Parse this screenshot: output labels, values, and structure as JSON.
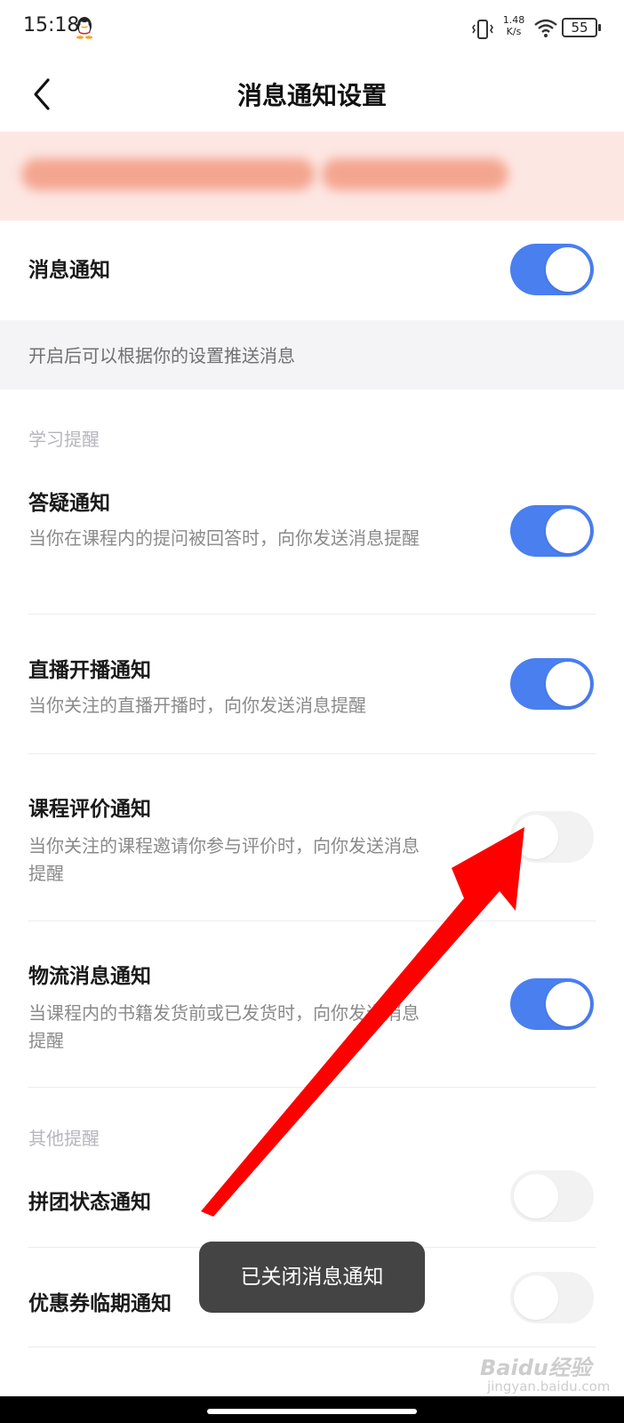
{
  "status_bar": {
    "time": "15:18",
    "net_speed_value": "1.48",
    "net_speed_unit": "K/s",
    "battery": "55",
    "icons": [
      "qq-icon",
      "vibrate-icon",
      "wifi-icon",
      "battery-icon"
    ]
  },
  "nav": {
    "title": "消息通知设置",
    "back_icon": "chevron-left-icon"
  },
  "main_toggle": {
    "label": "消息通知",
    "enabled": true
  },
  "hint": "开启后可以根据你的设置推送消息",
  "sections": [
    {
      "label": "学习提醒",
      "items": [
        {
          "title": "答疑通知",
          "desc": "当你在课程内的提问被回答时，向你发送消息提醒",
          "enabled": true
        },
        {
          "title": "直播开播通知",
          "desc": "当你关注的直播开播时，向你发送消息提醒",
          "enabled": true
        },
        {
          "title": "课程评价通知",
          "desc": "当你关注的课程邀请你参与评价时，向你发送消息提醒",
          "enabled": false
        },
        {
          "title": "物流消息通知",
          "desc": "当课程内的书籍发货前或已发货时，向你发送消息提醒",
          "enabled": true
        }
      ]
    },
    {
      "label": "其他提醒",
      "items": [
        {
          "title": "拼团状态通知",
          "enabled": false
        },
        {
          "title": "优惠券临期通知",
          "enabled": false
        }
      ]
    }
  ],
  "toast": "已关闭消息通知",
  "watermark": {
    "brand": "Baidu经验",
    "url": "jingyan.baidu.com"
  },
  "colors": {
    "toggle_on": "#4a7ff0",
    "toggle_off": "#f2f2f2",
    "arrow": "#ff0000",
    "hint_background": "#f4f4f6"
  }
}
